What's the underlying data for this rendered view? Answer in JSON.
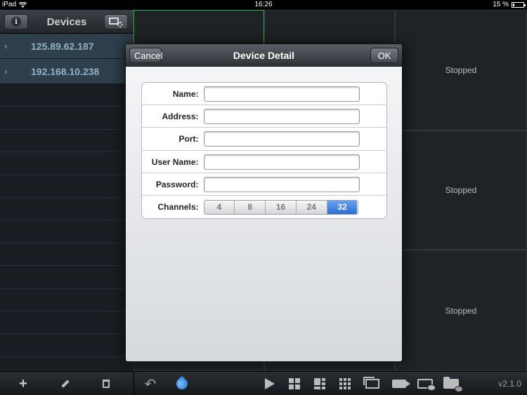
{
  "status_bar": {
    "device": "iPad",
    "time": "16:26",
    "battery": "15 %",
    "battery_level": 0.15
  },
  "sidebar": {
    "title": "Devices",
    "devices": [
      {
        "ip": "125.89.62.187"
      },
      {
        "ip": "192.168.10.238"
      }
    ]
  },
  "grid": {
    "stopped_label": "Stopped"
  },
  "toolbar": {
    "version": "v2.1.0"
  },
  "modal": {
    "title": "Device Detail",
    "cancel_label": "Cancel",
    "ok_label": "OK",
    "fields": {
      "name": {
        "label": "Name:",
        "value": ""
      },
      "address": {
        "label": "Address:",
        "value": ""
      },
      "port": {
        "label": "Port:",
        "value": ""
      },
      "username": {
        "label": "User Name:",
        "value": ""
      },
      "password": {
        "label": "Password:",
        "value": ""
      }
    },
    "channels": {
      "label": "Channels:",
      "options": [
        "4",
        "8",
        "16",
        "24",
        "32"
      ],
      "selected": "32"
    }
  }
}
